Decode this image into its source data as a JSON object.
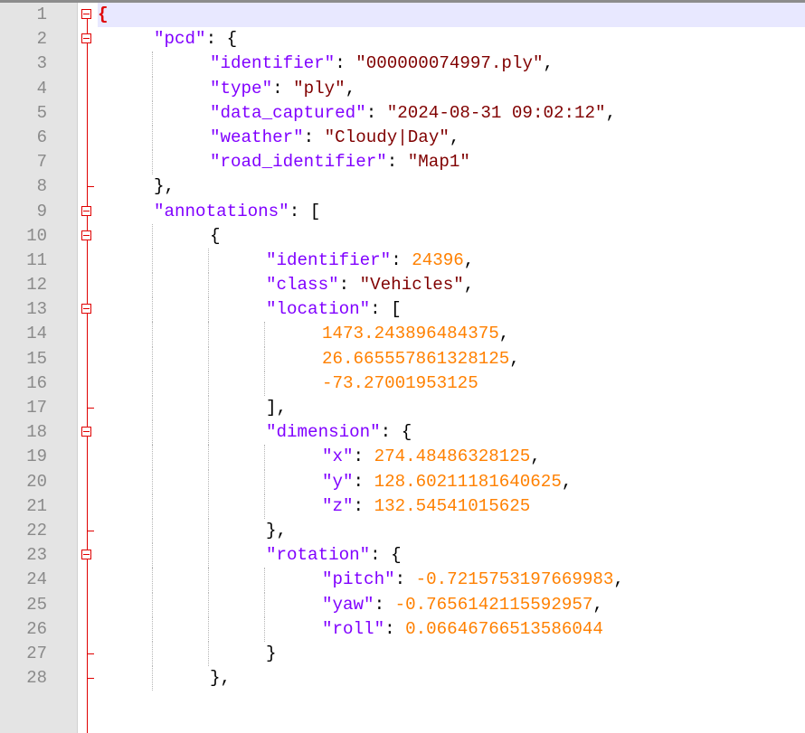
{
  "editor": {
    "current_line": 1,
    "colors": {
      "key": "#8000ff",
      "string": "#800000",
      "number": "#ff8000",
      "punctuation": "#000000",
      "line_number": "#8a8a8a",
      "fold_marker": "#e00000",
      "current_line_bg": "#e8e8ff"
    },
    "lines": [
      {
        "n": "1",
        "fold": "open",
        "indent": 0,
        "tokens": [
          {
            "t": "brace",
            "v": "{"
          }
        ]
      },
      {
        "n": "2",
        "fold": "open",
        "indent": 1,
        "tokens": [
          {
            "t": "key",
            "v": "\"pcd\""
          },
          {
            "t": "pun",
            "v": ": {"
          }
        ]
      },
      {
        "n": "3",
        "fold": "none",
        "indent": 2,
        "tokens": [
          {
            "t": "key",
            "v": "\"identifier\""
          },
          {
            "t": "pun",
            "v": ": "
          },
          {
            "t": "str",
            "v": "\"000000074997.ply\""
          },
          {
            "t": "pun",
            "v": ","
          }
        ]
      },
      {
        "n": "4",
        "fold": "none",
        "indent": 2,
        "tokens": [
          {
            "t": "key",
            "v": "\"type\""
          },
          {
            "t": "pun",
            "v": ": "
          },
          {
            "t": "str",
            "v": "\"ply\""
          },
          {
            "t": "pun",
            "v": ","
          }
        ]
      },
      {
        "n": "5",
        "fold": "none",
        "indent": 2,
        "tokens": [
          {
            "t": "key",
            "v": "\"data_captured\""
          },
          {
            "t": "pun",
            "v": ": "
          },
          {
            "t": "str",
            "v": "\"2024-08-31 09:02:12\""
          },
          {
            "t": "pun",
            "v": ","
          }
        ]
      },
      {
        "n": "6",
        "fold": "none",
        "indent": 2,
        "tokens": [
          {
            "t": "key",
            "v": "\"weather\""
          },
          {
            "t": "pun",
            "v": ": "
          },
          {
            "t": "str",
            "v": "\"Cloudy|Day\""
          },
          {
            "t": "pun",
            "v": ","
          }
        ]
      },
      {
        "n": "7",
        "fold": "none",
        "indent": 2,
        "tokens": [
          {
            "t": "key",
            "v": "\"road_identifier\""
          },
          {
            "t": "pun",
            "v": ": "
          },
          {
            "t": "str",
            "v": "\"Map1\""
          }
        ]
      },
      {
        "n": "8",
        "fold": "end",
        "indent": 1,
        "tokens": [
          {
            "t": "pun",
            "v": "},"
          }
        ]
      },
      {
        "n": "9",
        "fold": "open",
        "indent": 1,
        "tokens": [
          {
            "t": "key",
            "v": "\"annotations\""
          },
          {
            "t": "pun",
            "v": ": ["
          }
        ]
      },
      {
        "n": "10",
        "fold": "open",
        "indent": 2,
        "tokens": [
          {
            "t": "pun",
            "v": "{"
          }
        ]
      },
      {
        "n": "11",
        "fold": "none",
        "indent": 3,
        "tokens": [
          {
            "t": "key",
            "v": "\"identifier\""
          },
          {
            "t": "pun",
            "v": ": "
          },
          {
            "t": "num",
            "v": "24396"
          },
          {
            "t": "pun",
            "v": ","
          }
        ]
      },
      {
        "n": "12",
        "fold": "none",
        "indent": 3,
        "tokens": [
          {
            "t": "key",
            "v": "\"class\""
          },
          {
            "t": "pun",
            "v": ": "
          },
          {
            "t": "str",
            "v": "\"Vehicles\""
          },
          {
            "t": "pun",
            "v": ","
          }
        ]
      },
      {
        "n": "13",
        "fold": "open",
        "indent": 3,
        "tokens": [
          {
            "t": "key",
            "v": "\"location\""
          },
          {
            "t": "pun",
            "v": ": ["
          }
        ]
      },
      {
        "n": "14",
        "fold": "none",
        "indent": 4,
        "tokens": [
          {
            "t": "num",
            "v": "1473.243896484375"
          },
          {
            "t": "pun",
            "v": ","
          }
        ]
      },
      {
        "n": "15",
        "fold": "none",
        "indent": 4,
        "tokens": [
          {
            "t": "num",
            "v": "26.665557861328125"
          },
          {
            "t": "pun",
            "v": ","
          }
        ]
      },
      {
        "n": "16",
        "fold": "none",
        "indent": 4,
        "tokens": [
          {
            "t": "num",
            "v": "-73.27001953125"
          }
        ]
      },
      {
        "n": "17",
        "fold": "end",
        "indent": 3,
        "tokens": [
          {
            "t": "pun",
            "v": "],"
          }
        ]
      },
      {
        "n": "18",
        "fold": "open",
        "indent": 3,
        "tokens": [
          {
            "t": "key",
            "v": "\"dimension\""
          },
          {
            "t": "pun",
            "v": ": {"
          }
        ]
      },
      {
        "n": "19",
        "fold": "none",
        "indent": 4,
        "tokens": [
          {
            "t": "key",
            "v": "\"x\""
          },
          {
            "t": "pun",
            "v": ": "
          },
          {
            "t": "num",
            "v": "274.48486328125"
          },
          {
            "t": "pun",
            "v": ","
          }
        ]
      },
      {
        "n": "20",
        "fold": "none",
        "indent": 4,
        "tokens": [
          {
            "t": "key",
            "v": "\"y\""
          },
          {
            "t": "pun",
            "v": ": "
          },
          {
            "t": "num",
            "v": "128.60211181640625"
          },
          {
            "t": "pun",
            "v": ","
          }
        ]
      },
      {
        "n": "21",
        "fold": "none",
        "indent": 4,
        "tokens": [
          {
            "t": "key",
            "v": "\"z\""
          },
          {
            "t": "pun",
            "v": ": "
          },
          {
            "t": "num",
            "v": "132.54541015625"
          }
        ]
      },
      {
        "n": "22",
        "fold": "end",
        "indent": 3,
        "tokens": [
          {
            "t": "pun",
            "v": "},"
          }
        ]
      },
      {
        "n": "23",
        "fold": "open",
        "indent": 3,
        "tokens": [
          {
            "t": "key",
            "v": "\"rotation\""
          },
          {
            "t": "pun",
            "v": ": {"
          }
        ]
      },
      {
        "n": "24",
        "fold": "none",
        "indent": 4,
        "tokens": [
          {
            "t": "key",
            "v": "\"pitch\""
          },
          {
            "t": "pun",
            "v": ": "
          },
          {
            "t": "num",
            "v": "-0.7215753197669983"
          },
          {
            "t": "pun",
            "v": ","
          }
        ]
      },
      {
        "n": "25",
        "fold": "none",
        "indent": 4,
        "tokens": [
          {
            "t": "key",
            "v": "\"yaw\""
          },
          {
            "t": "pun",
            "v": ": "
          },
          {
            "t": "num",
            "v": "-0.7656142115592957"
          },
          {
            "t": "pun",
            "v": ","
          }
        ]
      },
      {
        "n": "26",
        "fold": "none",
        "indent": 4,
        "tokens": [
          {
            "t": "key",
            "v": "\"roll\""
          },
          {
            "t": "pun",
            "v": ": "
          },
          {
            "t": "num",
            "v": "0.06646766513586044"
          }
        ]
      },
      {
        "n": "27",
        "fold": "end",
        "indent": 3,
        "tokens": [
          {
            "t": "pun",
            "v": "}"
          }
        ]
      },
      {
        "n": "28",
        "fold": "end",
        "indent": 2,
        "tokens": [
          {
            "t": "pun",
            "v": "},"
          }
        ]
      }
    ]
  }
}
